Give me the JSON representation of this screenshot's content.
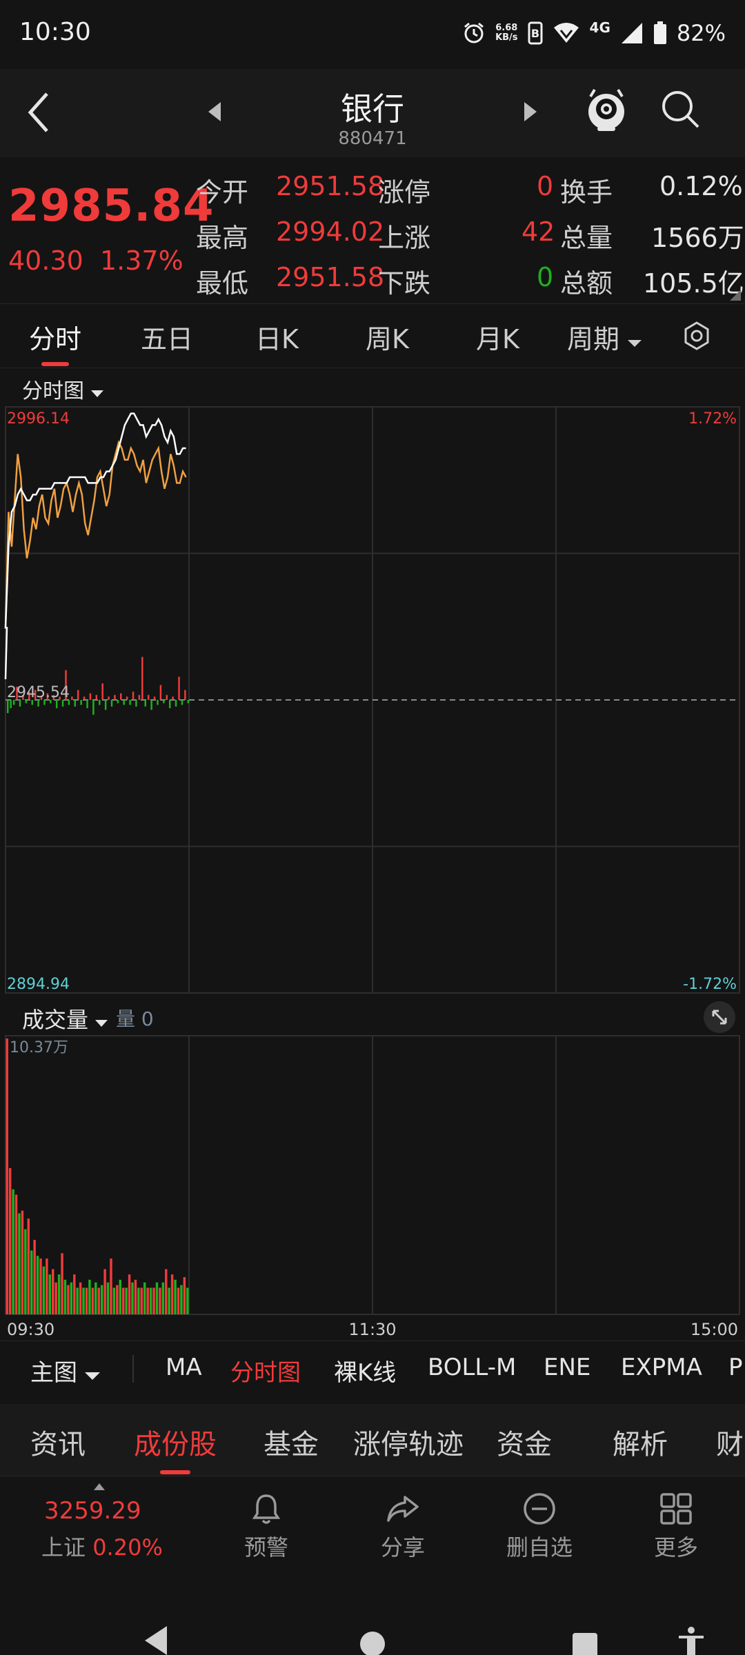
{
  "status": {
    "time": "10:30",
    "speed_value": "6.68",
    "speed_unit": "KB/s",
    "network": "4G",
    "battery": "82%"
  },
  "header": {
    "title": "银行",
    "code": "880471"
  },
  "quote": {
    "price": "2985.84",
    "change": "40.30",
    "change_pct": "1.37%",
    "open_label": "今开",
    "open": "2951.58",
    "high_label": "最高",
    "high": "2994.02",
    "low_label": "最低",
    "low": "2951.58",
    "limit_up_label": "涨停",
    "limit_up": "0",
    "up_label": "上涨",
    "up": "42",
    "down_label": "下跌",
    "down": "0",
    "turnover_label": "换手",
    "turnover": "0.12%",
    "volume_label": "总量",
    "volume": "1566万",
    "amount_label": "总额",
    "amount": "105.5亿"
  },
  "tabs": [
    "分时",
    "五日",
    "日K",
    "周K",
    "月K",
    "周期"
  ],
  "chart_label": "分时图",
  "volume_label": "成交量",
  "volume_count": "量 0",
  "colors": {
    "red": "#f03b3b",
    "green": "#1db11d",
    "price_line": "#ffffff",
    "avg_line": "#f0a040",
    "bg": "#141414"
  },
  "chart_data": {
    "type": "line",
    "title": "",
    "price_axis": {
      "max": 2996.14,
      "min": 2894.94,
      "base": 2945.54,
      "max_pct": "1.72%",
      "min_pct": "-1.72%"
    },
    "y_max_label": "2996.14",
    "y_min_label": "2894.94",
    "y_base_label": "2945.54",
    "pct_max_label": "1.72%",
    "pct_min_label": "-1.72%",
    "time_ticks": [
      "09:30",
      "11:30",
      "15:00"
    ],
    "minutes_total": 240,
    "series": [
      {
        "values": [
          2958,
          2978,
          2972,
          2980,
          2988,
          2984,
          2975,
          2970,
          2973,
          2977,
          2975,
          2979,
          2981,
          2977,
          2976,
          2980,
          2982,
          2977,
          2979,
          2982,
          2983,
          2981,
          2978,
          2981,
          2983,
          2981,
          2976,
          2974,
          2977,
          2980,
          2984,
          2985,
          2982,
          2979,
          2981,
          2986,
          2988,
          2990,
          2989,
          2987,
          2987,
          2989,
          2988,
          2986,
          2985,
          2987,
          2983,
          2985,
          2987,
          2988,
          2989,
          2985,
          2982,
          2984,
          2988,
          2986,
          2983,
          2983,
          2985,
          2984
        ]
      },
      {
        "values": [
          2958,
          2972,
          2978,
          2979,
          2981,
          2982,
          2981,
          2980,
          2980,
          2981,
          2981,
          2982,
          2982,
          2982,
          2982,
          2982,
          2983,
          2983,
          2983,
          2983,
          2983,
          2984,
          2984,
          2984,
          2984,
          2984,
          2984,
          2983,
          2983,
          2983,
          2983,
          2984,
          2984,
          2985,
          2985,
          2986,
          2987,
          2989,
          2991,
          2993,
          2994,
          2995,
          2995,
          2994,
          2993,
          2993,
          2991,
          2992,
          2993,
          2993,
          2994,
          2993,
          2991,
          2990,
          2992,
          2991,
          2988,
          2988,
          2989,
          2989
        ]
      }
    ],
    "diff_bars": [
      -8,
      -5,
      -3,
      8,
      -4,
      3,
      -2,
      5,
      -3,
      6,
      -4,
      2,
      -3,
      4,
      -2,
      3,
      -5,
      2,
      -4,
      18,
      -3,
      2,
      -4,
      6,
      -3,
      2,
      -5,
      4,
      -9,
      3,
      -3,
      10,
      -6,
      2,
      -4,
      3,
      -2,
      4,
      -3,
      2,
      -3,
      5,
      -4,
      3,
      26,
      -4,
      3,
      -6,
      2,
      -3,
      9,
      -2,
      3,
      -5,
      2,
      -4,
      14,
      -3,
      6,
      -2
    ],
    "volume_axis": {
      "max_label": "10.37万",
      "max": 10.37
    },
    "volumes": [
      10.37,
      5.5,
      4.7,
      4.5,
      3.8,
      3.9,
      3.2,
      3.6,
      2.4,
      2.8,
      2.2,
      2.1,
      1.8,
      2.1,
      1.5,
      1.7,
      1.2,
      1.5,
      2.3,
      1.3,
      1.1,
      1.2,
      1.5,
      1.0,
      1.2,
      1.0,
      1.0,
      1.3,
      1.0,
      1.2,
      1.0,
      1.1,
      1.7,
      1.2,
      2.1,
      1.0,
      1.1,
      1.3,
      1.0,
      1.0,
      1.5,
      1.2,
      1.3,
      1.0,
      1.0,
      1.2,
      1.0,
      1.0,
      1.0,
      1.2,
      1.0,
      1.2,
      1.7,
      1.0,
      1.5,
      1.3,
      1.0,
      1.1,
      1.4,
      1.0
    ],
    "volume_colors": [
      "r",
      "r",
      "g",
      "r",
      "g",
      "r",
      "g",
      "r",
      "g",
      "r",
      "g",
      "r",
      "g",
      "r",
      "g",
      "r",
      "r",
      "g",
      "r",
      "g",
      "r",
      "g",
      "r",
      "g",
      "r",
      "g",
      "r",
      "g",
      "r",
      "g",
      "r",
      "g",
      "r",
      "g",
      "r",
      "g",
      "r",
      "g",
      "r",
      "g",
      "r",
      "g",
      "r",
      "g",
      "r",
      "g",
      "r",
      "g",
      "r",
      "g",
      "r",
      "g",
      "r",
      "g",
      "r",
      "g",
      "r",
      "g",
      "r",
      "g"
    ]
  },
  "indicators": [
    "主图",
    "MA",
    "分时图",
    "裸K线",
    "BOLL-M",
    "ENE",
    "EXPMA",
    "P"
  ],
  "news_tabs": [
    "资讯",
    "成份股",
    "基金",
    "涨停轨迹",
    "资金",
    "解析",
    "财"
  ],
  "bottom": {
    "index_value": "3259.29",
    "index_name": "上证",
    "index_pct": "0.20%",
    "alert": "预警",
    "share": "分享",
    "remove": "删自选",
    "more": "更多"
  }
}
